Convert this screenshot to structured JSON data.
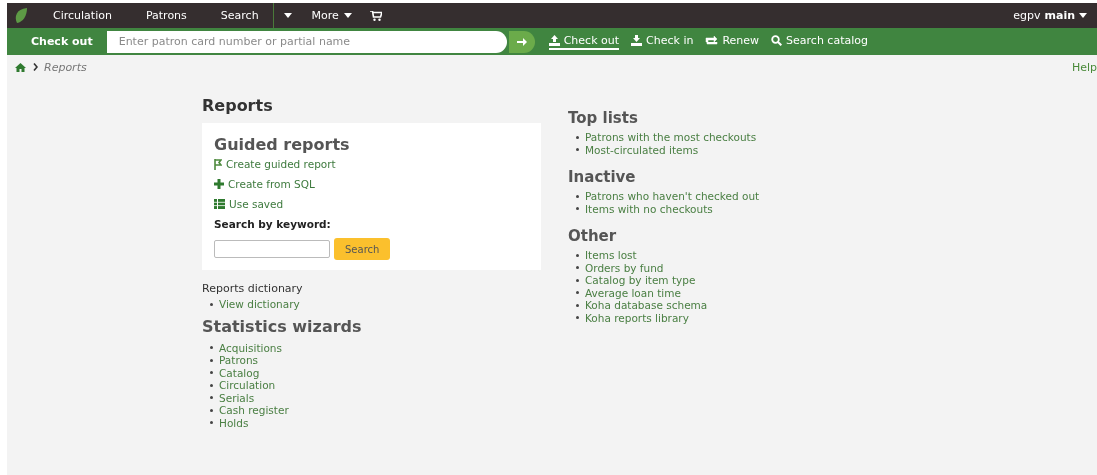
{
  "nav": {
    "items": [
      {
        "label": "Circulation"
      },
      {
        "label": "Patrons"
      },
      {
        "label": "Search"
      }
    ],
    "more": "More",
    "user": "egpv",
    "branch": "main"
  },
  "checkout_bar": {
    "label": "Check out",
    "placeholder": "Enter patron card number or partial name",
    "actions": [
      {
        "label": "Check out",
        "selected": true
      },
      {
        "label": "Check in",
        "selected": false
      },
      {
        "label": "Renew",
        "selected": false
      },
      {
        "label": "Search catalog",
        "selected": false
      }
    ]
  },
  "breadcrumb": {
    "current": "Reports"
  },
  "help": "Help",
  "page_title": "Reports",
  "guided": {
    "title": "Guided reports",
    "links": [
      {
        "label": "Create guided report"
      },
      {
        "label": "Create from SQL"
      },
      {
        "label": "Use saved"
      }
    ],
    "search_label": "Search by keyword:",
    "search_button": "Search"
  },
  "left_sections": [
    {
      "kind": "small",
      "title": "Reports dictionary",
      "links": [
        "View dictionary"
      ]
    },
    {
      "kind": "large",
      "title": "Statistics wizards",
      "links": [
        "Acquisitions",
        "Patrons",
        "Catalog",
        "Circulation",
        "Serials",
        "Cash register",
        "Holds"
      ]
    }
  ],
  "right_sections": [
    {
      "title": "Top lists",
      "links": [
        "Patrons with the most checkouts",
        "Most-circulated items"
      ]
    },
    {
      "title": "Inactive",
      "links": [
        "Patrons who haven't checked out",
        "Items with no checkouts"
      ]
    },
    {
      "title": "Other",
      "links": [
        "Items lost",
        "Orders by fund",
        "Catalog by item type",
        "Average loan time",
        "Koha database schema",
        "Koha reports library"
      ]
    }
  ]
}
